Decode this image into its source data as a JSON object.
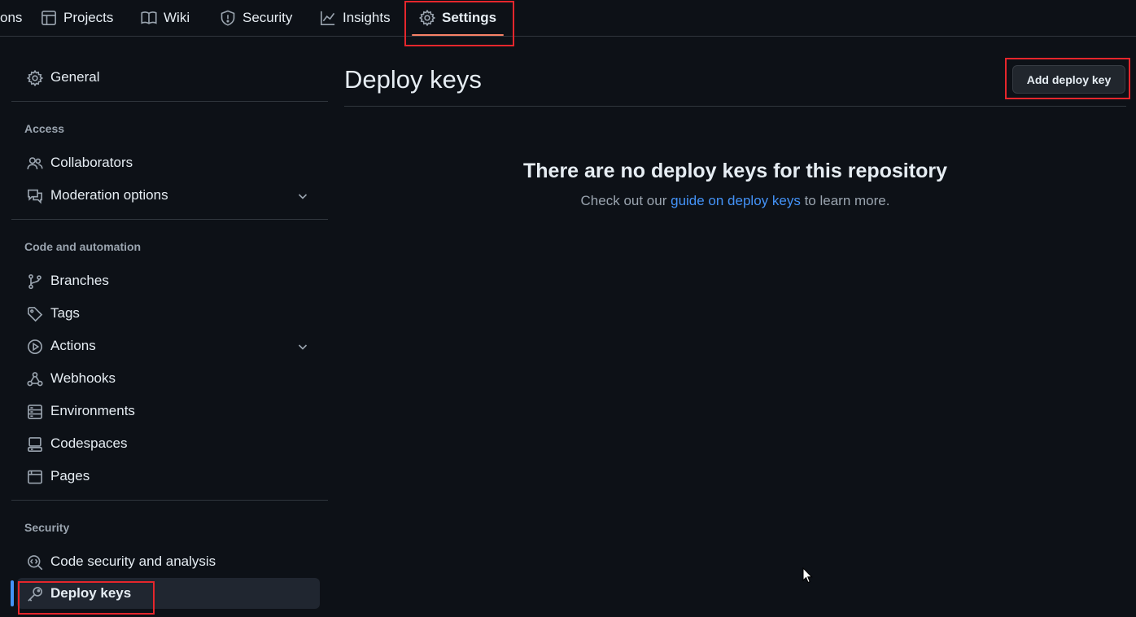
{
  "topnav": {
    "tabs": [
      {
        "label": "ons",
        "icon": "truncated"
      },
      {
        "label": "Projects",
        "icon": "table-icon"
      },
      {
        "label": "Wiki",
        "icon": "book-icon"
      },
      {
        "label": "Security",
        "icon": "shield-icon"
      },
      {
        "label": "Insights",
        "icon": "graph-icon"
      },
      {
        "label": "Settings",
        "icon": "gear-icon",
        "active": true
      }
    ]
  },
  "sidebar": {
    "general": "General",
    "sections": [
      {
        "heading": "Access",
        "items": [
          "Collaborators",
          "Moderation options"
        ]
      },
      {
        "heading": "Code and automation",
        "items": [
          "Branches",
          "Tags",
          "Actions",
          "Webhooks",
          "Environments",
          "Codespaces",
          "Pages"
        ]
      },
      {
        "heading": "Security",
        "items": [
          "Code security and analysis",
          "Deploy keys"
        ]
      }
    ],
    "selected": "Deploy keys"
  },
  "main": {
    "title": "Deploy keys",
    "add_button": "Add deploy key",
    "empty_title": "There are no deploy keys for this repository",
    "empty_prefix": "Check out our",
    "empty_link": "guide on deploy keys",
    "empty_suffix": "to learn more."
  },
  "colors": {
    "background": "#0d1117",
    "text": "#e6edf3",
    "muted": "#9aa4af",
    "link": "#4493f8",
    "accent_underline": "#f78166",
    "highlight_box": "#e5262c"
  }
}
